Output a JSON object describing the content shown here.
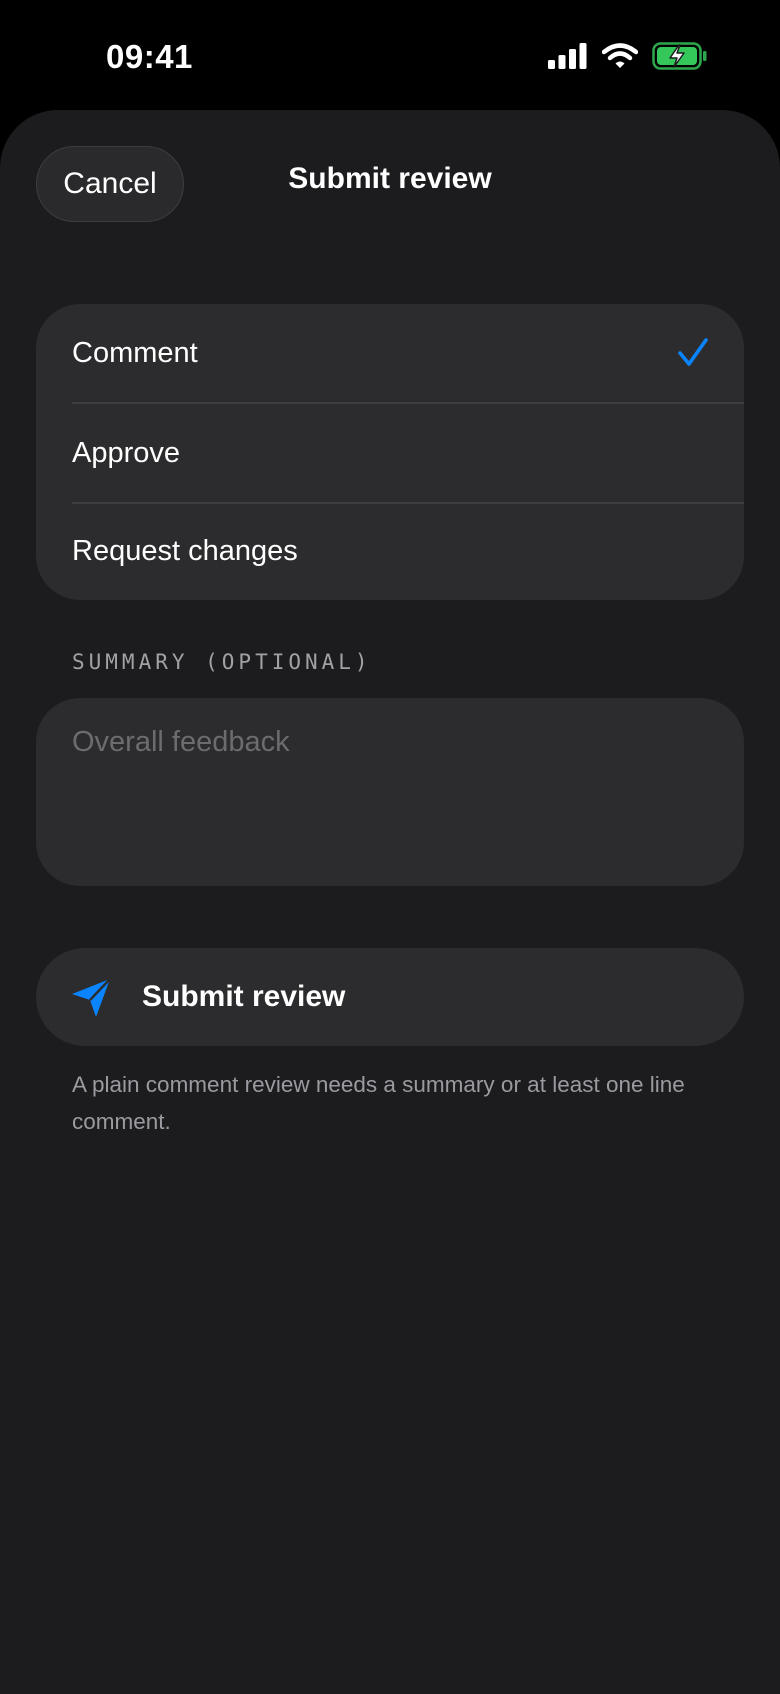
{
  "status_bar": {
    "time": "09:41",
    "icons": [
      "cellular-signal-icon",
      "wifi-icon",
      "battery-charging-icon"
    ],
    "battery_color": "#34c759"
  },
  "sheet": {
    "cancel_label": "Cancel",
    "title": "Submit review"
  },
  "review_options": {
    "items": [
      {
        "label": "Comment",
        "selected": true
      },
      {
        "label": "Approve",
        "selected": false
      },
      {
        "label": "Request changes",
        "selected": false
      }
    ],
    "check_icon": "checkmark-icon",
    "accent_color": "#0a84ff"
  },
  "summary": {
    "label": "SUMMARY (OPTIONAL)",
    "placeholder": "Overall feedback",
    "value": ""
  },
  "submit": {
    "icon": "send-icon",
    "label": "Submit review",
    "helper_text": "A plain comment review needs a summary or at least one line comment."
  }
}
